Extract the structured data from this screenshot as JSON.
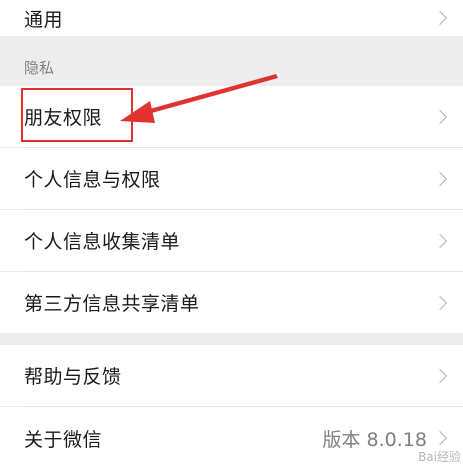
{
  "settings": {
    "general": {
      "label": "通用"
    },
    "privacy_section": {
      "title": "隐私"
    },
    "items": [
      {
        "label": "朋友权限"
      },
      {
        "label": "个人信息与权限"
      },
      {
        "label": "个人信息收集清单"
      },
      {
        "label": "第三方信息共享清单"
      }
    ],
    "help": {
      "label": "帮助与反馈"
    },
    "about": {
      "label": "关于微信",
      "version": "版本 8.0.18"
    }
  },
  "annotation": {
    "highlight_color": "#e0322f",
    "highlighted_item": "朋友权限"
  },
  "watermark": {
    "text": "Bai经验"
  }
}
